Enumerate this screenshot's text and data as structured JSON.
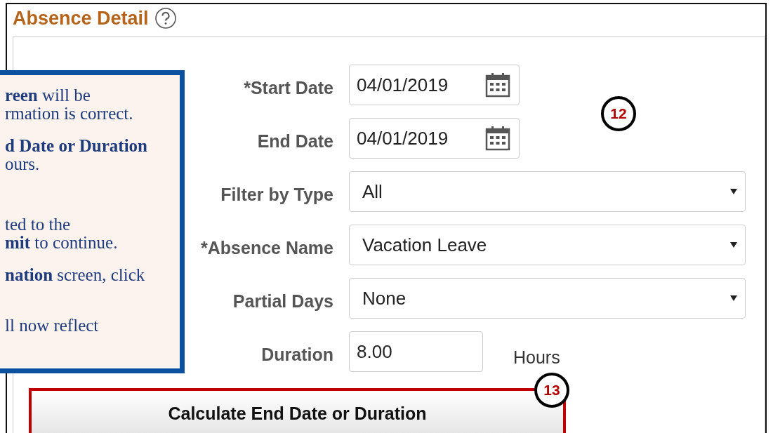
{
  "section": {
    "title": "Absence Detail"
  },
  "fields": [
    {
      "kind": "date",
      "label": "*Start Date",
      "value": "04/01/2019"
    },
    {
      "kind": "date",
      "label": "End Date",
      "value": "04/01/2019"
    },
    {
      "kind": "select",
      "label": "Filter by Type",
      "value": "All"
    },
    {
      "kind": "select",
      "label": "*Absence Name",
      "value": "Vacation Leave"
    },
    {
      "kind": "select",
      "label": "Partial Days",
      "value": "None"
    },
    {
      "kind": "number",
      "label": "Duration",
      "value": "8.00",
      "unit": "Hours"
    }
  ],
  "button": {
    "label": "Calculate End Date or Duration"
  },
  "callout": {
    "lines": [
      "**reen** will be",
      "rmation is correct.",
      "**d Date or Duration**",
      "ours.",
      "ted to the",
      "**mit** to continue.",
      "**nation** screen, click",
      "ll now reflect"
    ]
  },
  "steps": [
    {
      "number": "12"
    },
    {
      "number": "13"
    }
  ]
}
